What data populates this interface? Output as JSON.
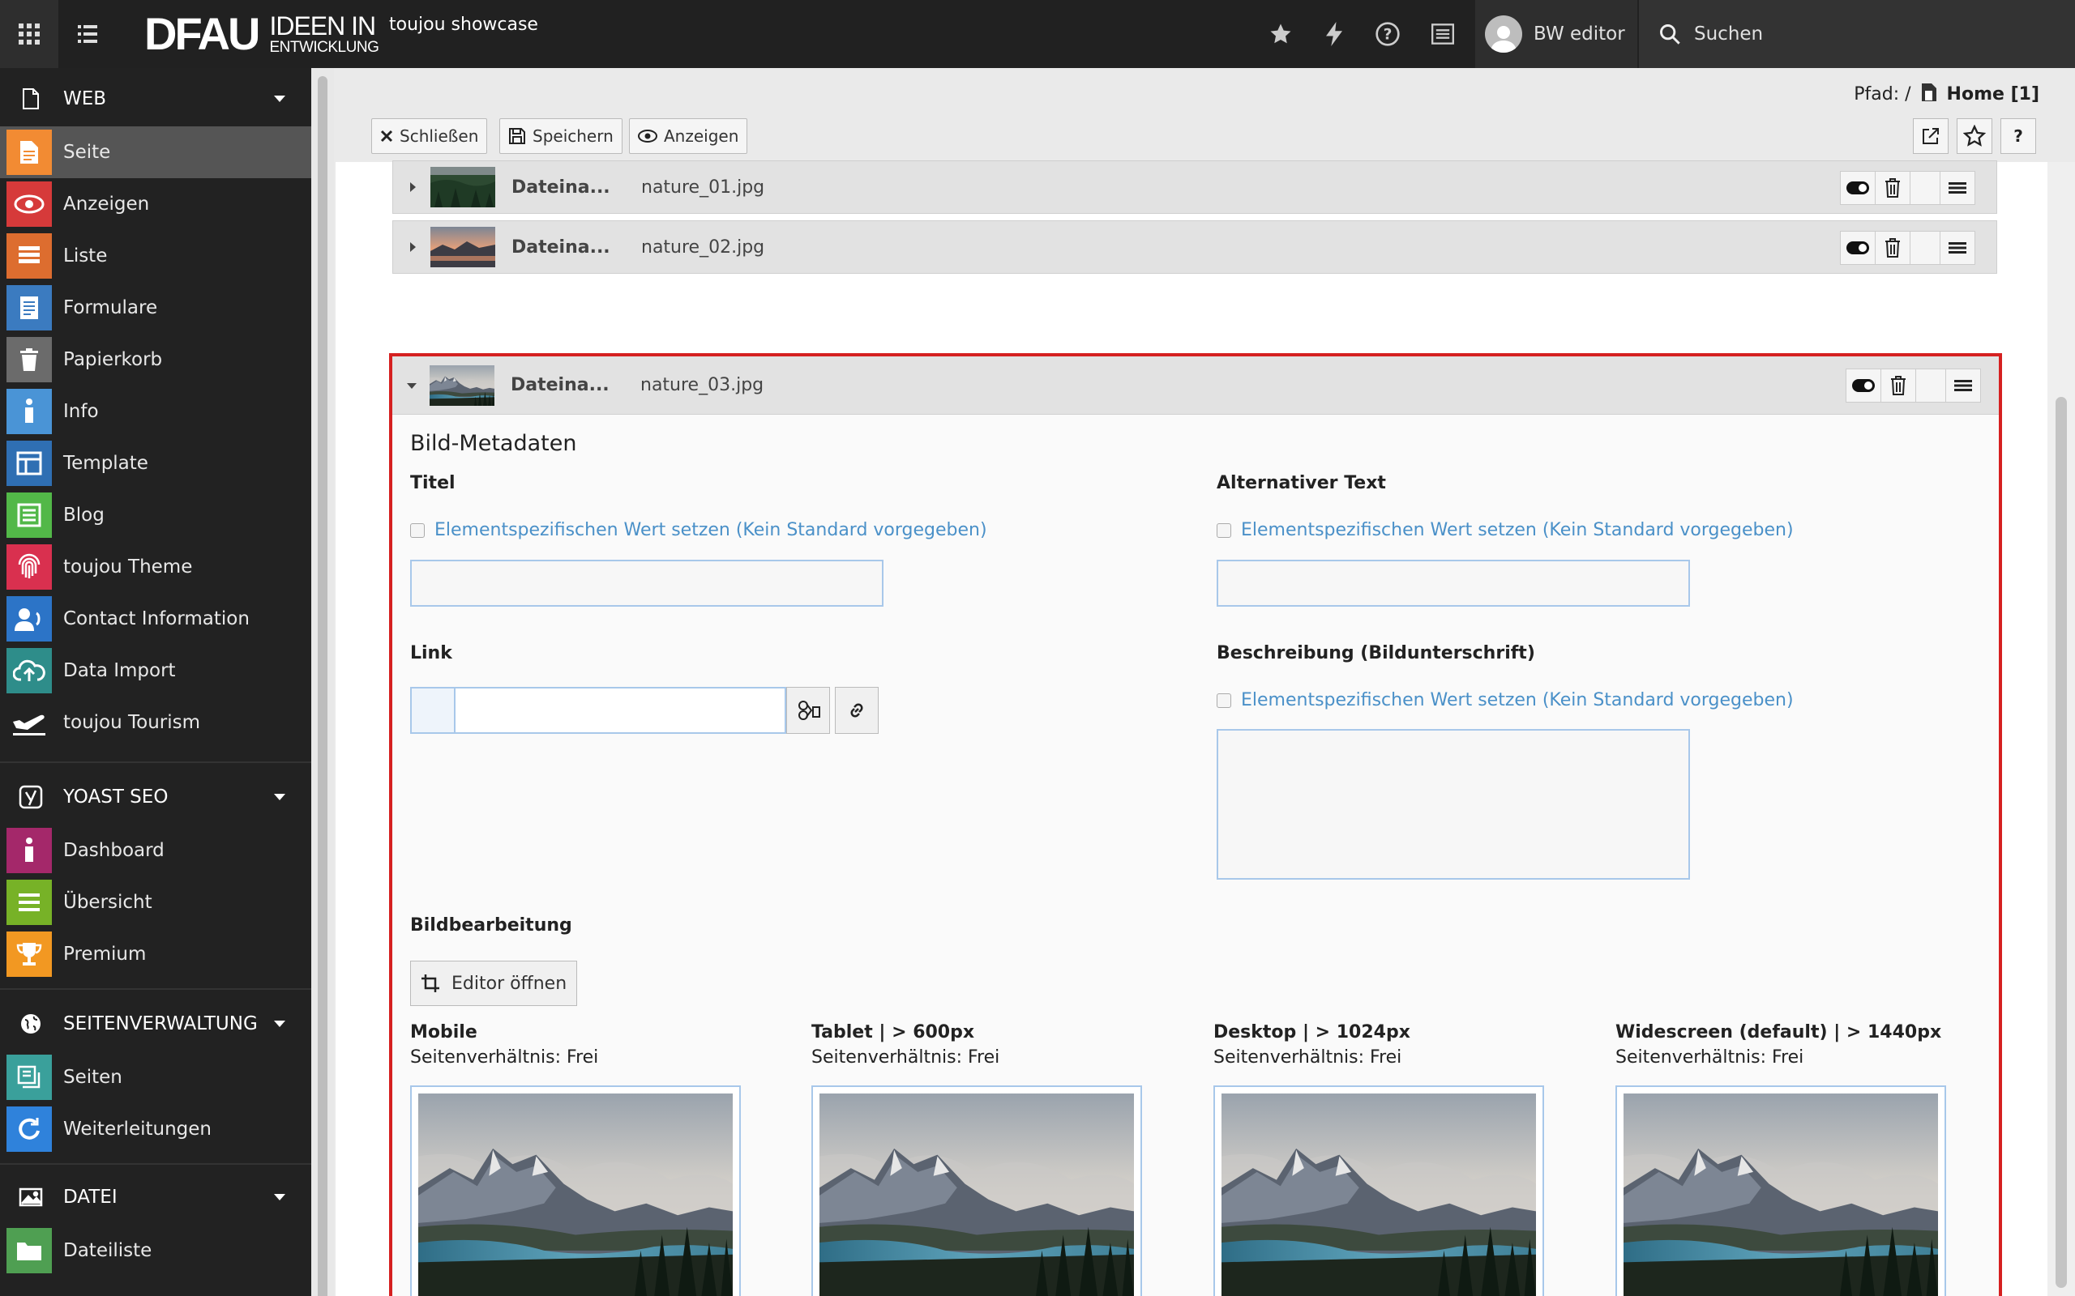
{
  "topbar": {
    "logo_main": "DFAU",
    "logo_line1": "IDEEN IN",
    "logo_line2": "ENTWICKLUNG",
    "site_name": "toujou showcase",
    "user_name": "BW editor",
    "search_label": "Suchen"
  },
  "sidebar": {
    "groups": [
      {
        "label": "WEB",
        "items": [
          {
            "label": "Seite",
            "color": "#f28b33",
            "active": true
          },
          {
            "label": "Anzeigen",
            "color": "#d63a3a"
          },
          {
            "label": "Liste",
            "color": "#dd6d2f"
          },
          {
            "label": "Formulare",
            "color": "#3b7bc0"
          },
          {
            "label": "Papierkorb",
            "color": "#6b6b6b"
          },
          {
            "label": "Info",
            "color": "#4a94d6"
          },
          {
            "label": "Template",
            "color": "#2f6fb3"
          },
          {
            "label": "Blog",
            "color": "#52b848"
          },
          {
            "label": "toujou Theme",
            "color": "#d9304f"
          },
          {
            "label": "Contact Information",
            "color": "#2c74c7"
          },
          {
            "label": "Data Import",
            "color": "#2e8d8a"
          },
          {
            "label": "toujou Tourism",
            "color": "#222222"
          }
        ]
      },
      {
        "label": "YOAST SEO",
        "items": [
          {
            "label": "Dashboard",
            "color": "#a4286a"
          },
          {
            "label": "Übersicht",
            "color": "#77b227"
          },
          {
            "label": "Premium",
            "color": "#f29822"
          }
        ]
      },
      {
        "label": "SEITENVERWALTUNG",
        "items": [
          {
            "label": "Seiten",
            "color": "#3aa09b"
          },
          {
            "label": "Weiterleitungen",
            "color": "#2f82db"
          }
        ]
      },
      {
        "label": "DATEI",
        "items": [
          {
            "label": "Dateiliste",
            "color": "#4f9f52"
          }
        ]
      }
    ]
  },
  "docheader": {
    "path_label": "Pfad: /",
    "path_home": "Home [1]",
    "close_label": "Schließen",
    "save_label": "Speichern",
    "view_label": "Anzeigen",
    "help_label": "?"
  },
  "files": [
    {
      "label": "Dateina...",
      "name": "nature_01.jpg"
    },
    {
      "label": "Dateina...",
      "name": "nature_02.jpg"
    },
    {
      "label": "Dateina...",
      "name": "nature_03.jpg"
    }
  ],
  "metadata": {
    "section_title": "Bild-Metadaten",
    "title_label": "Titel",
    "alt_label": "Alternativer Text",
    "link_label": "Link",
    "desc_label": "Beschreibung (Bildunterschrift)",
    "override_text": "Elementspezifischen Wert setzen (Kein Standard vorgegeben)",
    "title_value": "",
    "alt_value": "",
    "link_value": "",
    "desc_value": ""
  },
  "image_editing": {
    "title": "Bildbearbeitung",
    "editor_button": "Editor öffnen",
    "variants": [
      {
        "name": "Mobile",
        "ratio": "Seitenverhältnis: Frei"
      },
      {
        "name": "Tablet | > 600px",
        "ratio": "Seitenverhältnis: Frei"
      },
      {
        "name": "Desktop | > 1024px",
        "ratio": "Seitenverhältnis: Frei"
      },
      {
        "name": "Widescreen (default) | > 1440px",
        "ratio": "Seitenverhältnis: Frei"
      }
    ]
  }
}
